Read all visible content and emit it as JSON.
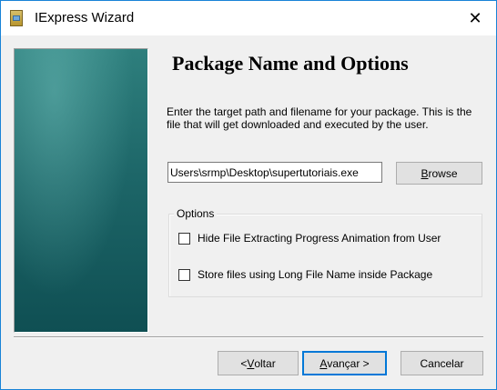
{
  "window": {
    "title": "IExpress Wizard",
    "close_symbol": "✕"
  },
  "page": {
    "title": "Package Name and Options",
    "description": "Enter the target path and filename for your package. This is the file that will get downloaded and executed by the user."
  },
  "path_input": {
    "value": "Users\\srmp\\Desktop\\supertutoriais.exe"
  },
  "browse_button": {
    "prefix": "",
    "accel": "B",
    "suffix": "rowse"
  },
  "options": {
    "legend": "Options",
    "items": [
      {
        "label": "Hide File Extracting Progress Animation from User",
        "checked": false
      },
      {
        "label": "Store files using Long File Name inside Package",
        "checked": false
      }
    ]
  },
  "footer": {
    "back": {
      "prefix": "< ",
      "accel": "V",
      "suffix": "oltar"
    },
    "next": {
      "prefix": "",
      "accel": "A",
      "suffix": "vançar >"
    },
    "cancel_label": "Cancelar"
  },
  "colors": {
    "accent": "#0078d7",
    "sidebar_top": "#2e7f7d",
    "sidebar_bottom": "#0f4f53"
  }
}
